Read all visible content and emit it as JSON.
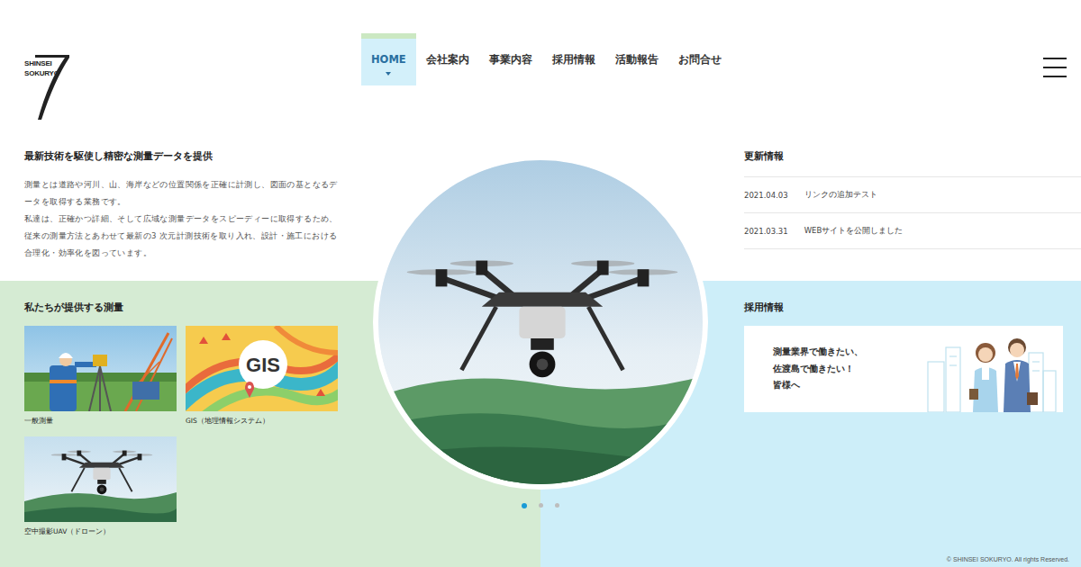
{
  "logo": {
    "line1": "SHINSEI",
    "line2": "SOKURYO"
  },
  "nav": [
    {
      "label": "HOME",
      "selected": true
    },
    {
      "label": "会社案内",
      "selected": false
    },
    {
      "label": "事業内容",
      "selected": false
    },
    {
      "label": "採用情報",
      "selected": false
    },
    {
      "label": "活動報告",
      "selected": false
    },
    {
      "label": "お問合せ",
      "selected": false
    }
  ],
  "intro": {
    "title": "最新技術を駆使し精密な測量データを提供",
    "paragraphs": [
      "測量とは道路や河川、山、海岸などの位置関係を正確に計測し、図面の基となるデータを取得する業務です。",
      "私達は、正確かつ詳細、そして広域な測量データをスピーディーに取得するため、従来の測量方法とあわせて最新の3 次元計測技術を取り入れ、設計・施工における合理化・効率化を図っています。"
    ]
  },
  "news": {
    "title": "更新情報",
    "items": [
      {
        "date": "2021.04.03",
        "text": "リンクの追加テスト"
      },
      {
        "date": "2021.03.31",
        "text": "WEBサイトを公開しました"
      }
    ]
  },
  "services": {
    "title": "私たちが提供する測量",
    "items": [
      {
        "label": "一般測量",
        "kind": "survey"
      },
      {
        "label": "GIS（地理情報システム）",
        "kind": "gis",
        "badge": "GIS"
      },
      {
        "label": "空中撮影UAV（ドローン）",
        "kind": "drone"
      }
    ]
  },
  "recruit": {
    "title": "採用情報",
    "lines": [
      "測量業界で働きたい、",
      "佐渡島で働きたい！",
      "皆様へ"
    ]
  },
  "slider": [
    {
      "selected": true
    },
    {
      "selected": false
    },
    {
      "selected": false
    }
  ],
  "footer": "© SHINSEI SOKURYO. All rights Reserved."
}
